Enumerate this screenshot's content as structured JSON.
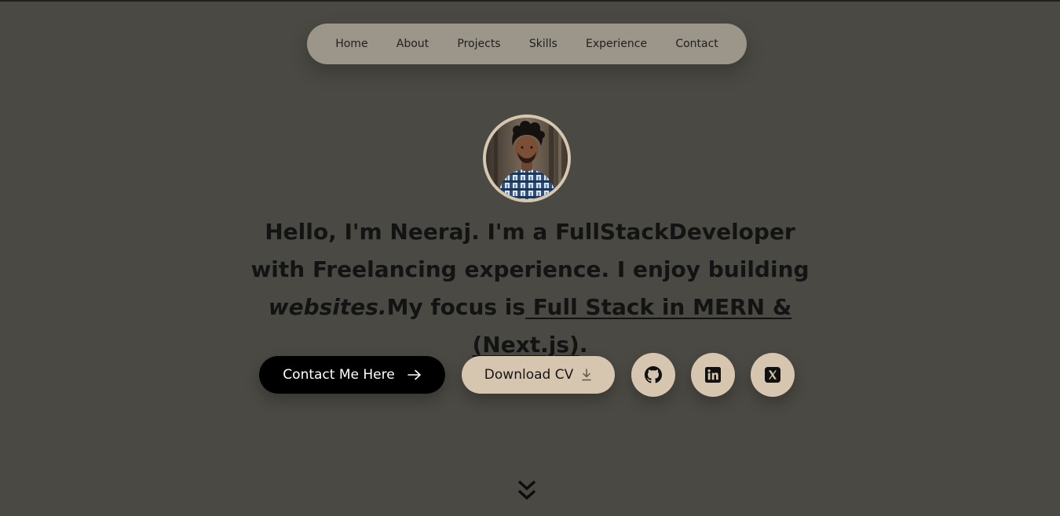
{
  "nav": {
    "items": [
      {
        "label": "Home"
      },
      {
        "label": "About"
      },
      {
        "label": "Projects"
      },
      {
        "label": "Skills"
      },
      {
        "label": "Experience"
      },
      {
        "label": "Contact"
      }
    ]
  },
  "hero": {
    "p1": "Hello, I'm Neeraj.",
    "p2": " I'm a ",
    "p3": "FullStackDeveloper",
    "p4": "with ",
    "p5": "Freelancing",
    "p6": " experience. I enjoy building",
    "p7": "websites.",
    "p8": "My focus is",
    "p9": " Full Stack in MERN &(Next.js)",
    "p10": "."
  },
  "buttons": {
    "contact_label": "Contact Me Here",
    "cv_label": "Download CV"
  },
  "icons": {
    "contact": "arrow-right-icon",
    "cv": "download-icon",
    "github": "github-icon",
    "linkedin": "linkedin-icon",
    "x": "x-icon",
    "scroll": "chevrons-down-icon"
  },
  "colors": {
    "background": "#4a4943",
    "nav_bg": "#9c958a",
    "accent": "#d7c6af",
    "primary_button": "#000000"
  }
}
